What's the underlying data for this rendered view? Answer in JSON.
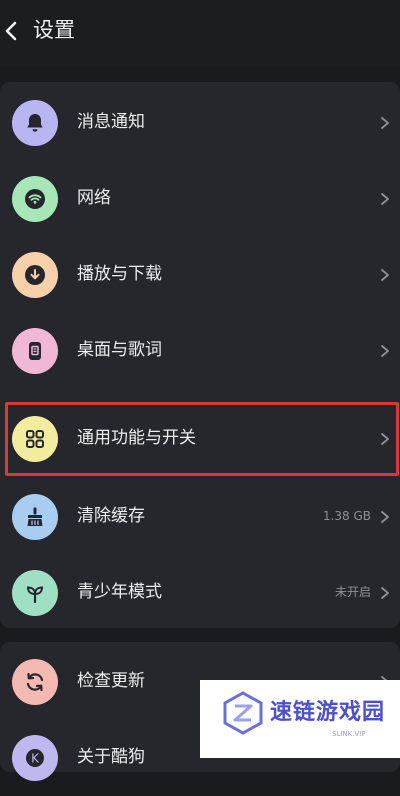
{
  "header": {
    "back_icon": "chevron-left-icon",
    "title": "设置"
  },
  "menu": [
    {
      "label": "消息通知",
      "icon": "bell-icon",
      "color": "#b9b4f2",
      "value": ""
    },
    {
      "label": "网络",
      "icon": "wifi-icon",
      "color": "#a7e6b6",
      "value": ""
    },
    {
      "label": "播放与下载",
      "icon": "download-icon",
      "color": "#f5d0a9",
      "value": ""
    },
    {
      "label": "桌面与歌词",
      "icon": "lyrics-icon",
      "color": "#f0b8d3",
      "value": ""
    },
    {
      "label": "通用功能与开关",
      "icon": "grid-icon",
      "color": "#f2ec9f",
      "value": ""
    },
    {
      "label": "清除缓存",
      "icon": "broom-icon",
      "color": "#a8cdf1",
      "value": "1.38 GB"
    },
    {
      "label": "青少年模式",
      "icon": "sprout-icon",
      "color": "#9fe0c4",
      "value": "未开启"
    },
    {
      "label": "检查更新",
      "icon": "refresh-icon",
      "color": "#f4b9b3",
      "value": ""
    },
    {
      "label": "关于酷狗",
      "icon": "kugou-icon",
      "color": "#bdb8f0",
      "value": ""
    }
  ],
  "watermark": {
    "text": "速链游戏园",
    "sub": "SLINK.VIP"
  }
}
